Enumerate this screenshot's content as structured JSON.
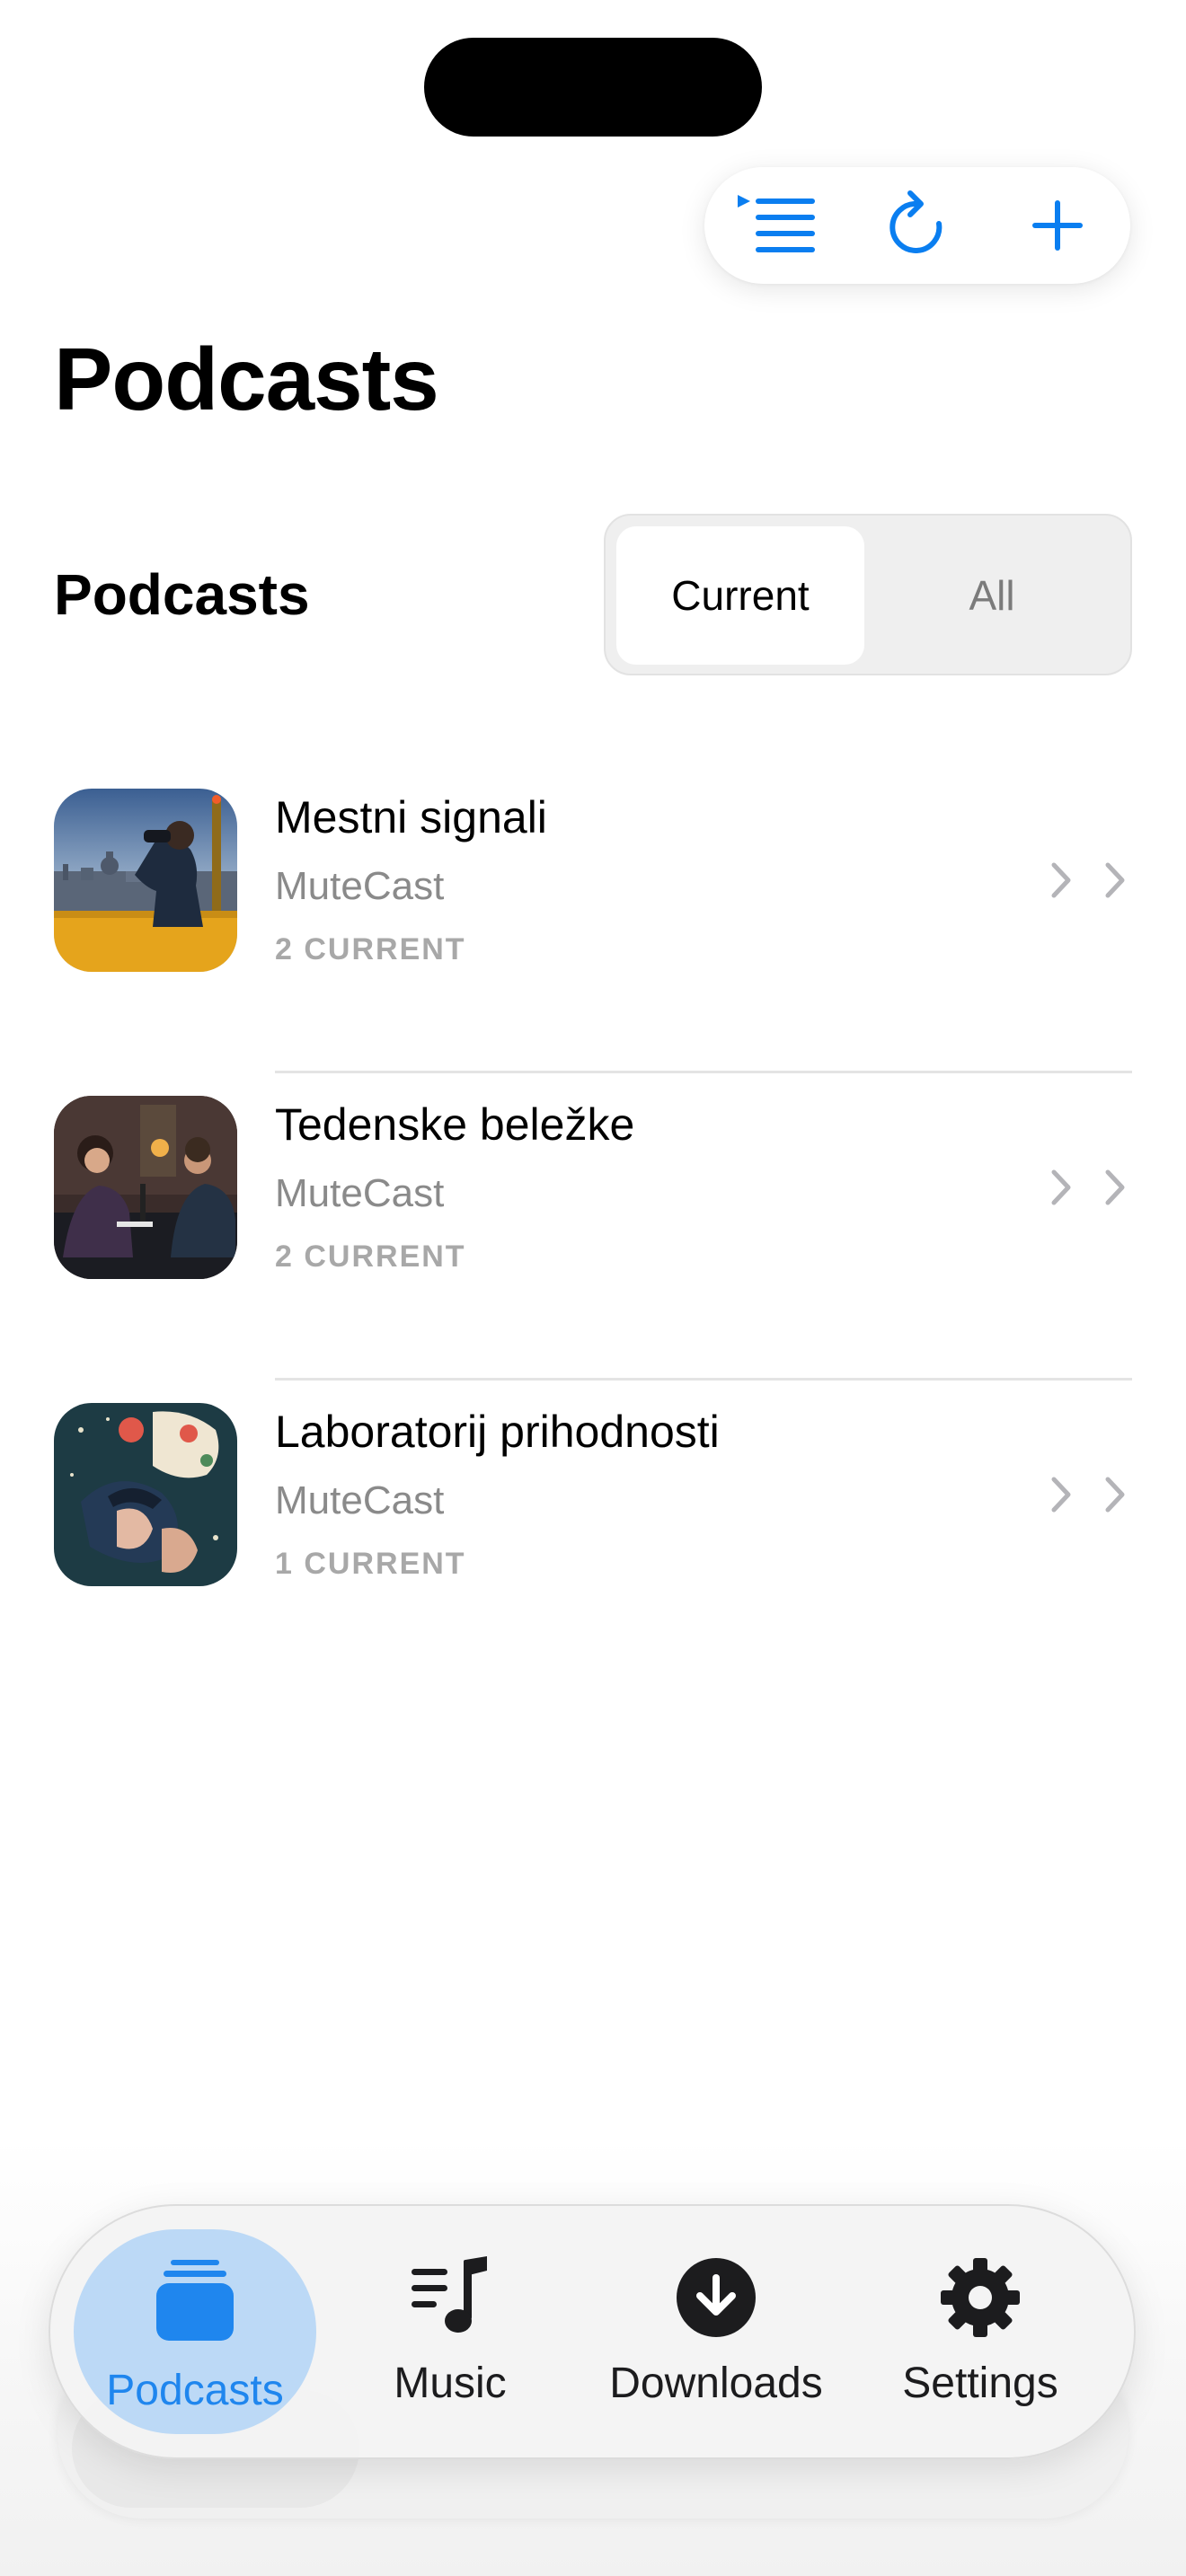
{
  "header": {
    "large_title": "Podcasts"
  },
  "toolbar": {
    "queue_icon": "list-bullet-play-icon",
    "refresh_icon": "arrow-clockwise-icon",
    "add_icon": "plus-icon",
    "accent_color": "#0a7ef0"
  },
  "section": {
    "title": "Podcasts",
    "segments": [
      "Current",
      "All"
    ],
    "selected": "Current"
  },
  "podcasts": [
    {
      "title": "Mestni signali",
      "author": "MuteCast",
      "count": "2 CURRENT",
      "art": "city-rooftop-binoculars-artwork"
    },
    {
      "title": "Tedenske beležke",
      "author": "MuteCast",
      "count": "2 CURRENT",
      "art": "studio-conversation-artwork"
    },
    {
      "title": "Laboratorij prihodnosti",
      "author": "MuteCast",
      "count": "1 CURRENT",
      "art": "space-illustration-artwork"
    }
  ],
  "tabbar": {
    "tabs": [
      {
        "label": "Podcasts",
        "icon": "stack-icon",
        "active": true
      },
      {
        "label": "Music",
        "icon": "music-list-icon",
        "active": false
      },
      {
        "label": "Downloads",
        "icon": "download-circle-icon",
        "active": false
      },
      {
        "label": "Settings",
        "icon": "gear-icon",
        "active": false
      }
    ],
    "active_color": "#1f86ee"
  }
}
